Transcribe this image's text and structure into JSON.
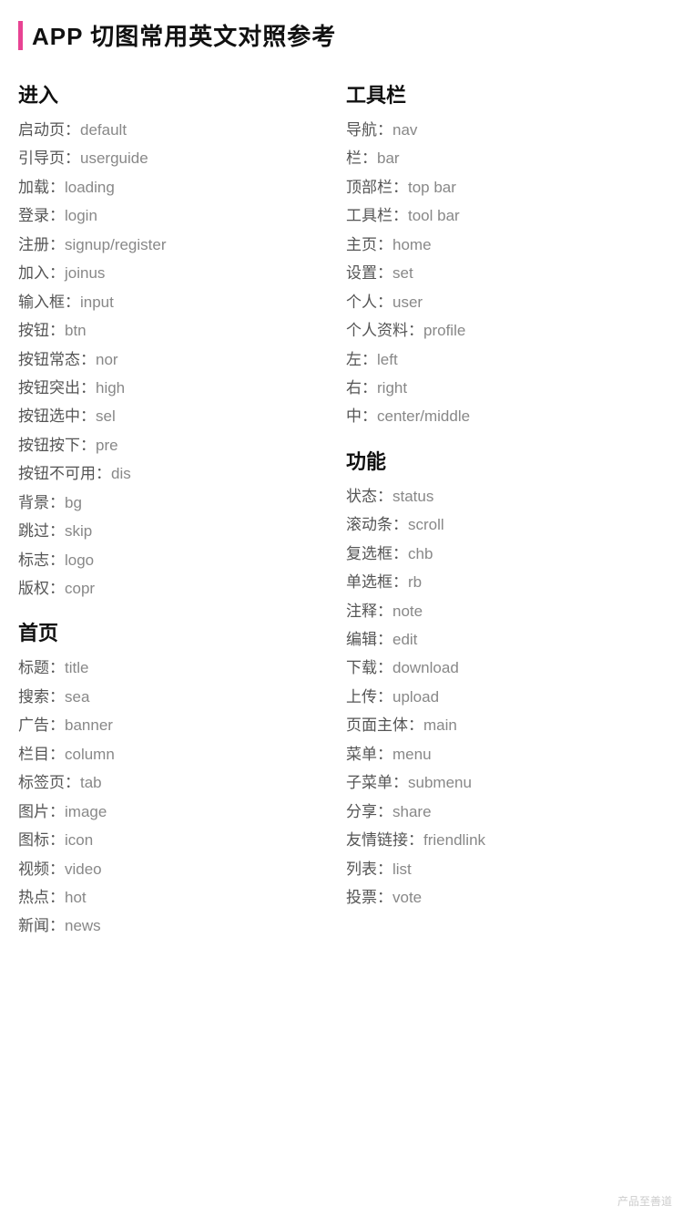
{
  "header": {
    "title": "APP 切图常用英文对照参考",
    "accentColor": "#e84393"
  },
  "columns": [
    {
      "sections": [
        {
          "title": "进入",
          "entries": [
            {
              "zh": "启动页：",
              "en": "default"
            },
            {
              "zh": "引导页：",
              "en": "userguide"
            },
            {
              "zh": "加载：",
              "en": "loading"
            },
            {
              "zh": "登录：",
              "en": "login"
            },
            {
              "zh": "注册：",
              "en": "signup/register"
            },
            {
              "zh": "加入：",
              "en": "joinus"
            },
            {
              "zh": "输入框：",
              "en": "input"
            },
            {
              "zh": "按钮：",
              "en": "btn"
            },
            {
              "zh": "按钮常态：",
              "en": "nor"
            },
            {
              "zh": "按钮突出：",
              "en": "high"
            },
            {
              "zh": "按钮选中：",
              "en": "sel"
            },
            {
              "zh": "按钮按下：",
              "en": "pre"
            },
            {
              "zh": "按钮不可用：",
              "en": "dis"
            },
            {
              "zh": "背景：",
              "en": "bg"
            },
            {
              "zh": "跳过：",
              "en": "skip"
            },
            {
              "zh": "标志：",
              "en": "logo"
            },
            {
              "zh": "版权：",
              "en": "copr"
            }
          ]
        },
        {
          "title": "首页",
          "entries": [
            {
              "zh": "标题：",
              "en": "title"
            },
            {
              "zh": "搜索：",
              "en": "sea"
            },
            {
              "zh": "广告：",
              "en": "banner"
            },
            {
              "zh": "栏目：",
              "en": "column"
            },
            {
              "zh": "标签页：",
              "en": "tab"
            },
            {
              "zh": "图片：",
              "en": "image"
            },
            {
              "zh": "图标：",
              "en": "icon"
            },
            {
              "zh": "视频：",
              "en": "video"
            },
            {
              "zh": "热点：",
              "en": "hot"
            },
            {
              "zh": "新闻：",
              "en": "news"
            }
          ]
        }
      ]
    },
    {
      "sections": [
        {
          "title": "工具栏",
          "entries": [
            {
              "zh": "导航：",
              "en": "nav"
            },
            {
              "zh": "栏：",
              "en": "bar"
            },
            {
              "zh": "顶部栏：",
              "en": "top bar"
            },
            {
              "zh": "工具栏：",
              "en": "tool bar"
            },
            {
              "zh": "主页：",
              "en": "home"
            },
            {
              "zh": "设置：",
              "en": "set"
            },
            {
              "zh": "个人：",
              "en": "user"
            },
            {
              "zh": "个人资料：",
              "en": "profile"
            },
            {
              "zh": "左：",
              "en": "left"
            },
            {
              "zh": "右：",
              "en": "right"
            },
            {
              "zh": "中：",
              "en": "center/middle"
            }
          ]
        },
        {
          "title": "功能",
          "entries": [
            {
              "zh": "状态：",
              "en": "status"
            },
            {
              "zh": "滚动条：",
              "en": "scroll"
            },
            {
              "zh": "复选框：",
              "en": "chb"
            },
            {
              "zh": "单选框：",
              "en": "rb"
            },
            {
              "zh": "注释：",
              "en": "note"
            },
            {
              "zh": "编辑：",
              "en": "edit"
            },
            {
              "zh": "下载：",
              "en": "download"
            },
            {
              "zh": "上传：",
              "en": "upload"
            },
            {
              "zh": "页面主体：",
              "en": "main"
            },
            {
              "zh": "菜单：",
              "en": "menu"
            },
            {
              "zh": "子菜单：",
              "en": "submenu"
            },
            {
              "zh": "分享：",
              "en": "share"
            },
            {
              "zh": "友情链接：",
              "en": "friendlink"
            },
            {
              "zh": "列表：",
              "en": "list"
            },
            {
              "zh": "投票：",
              "en": "vote"
            }
          ]
        }
      ]
    }
  ],
  "watermark": "产品至善道"
}
